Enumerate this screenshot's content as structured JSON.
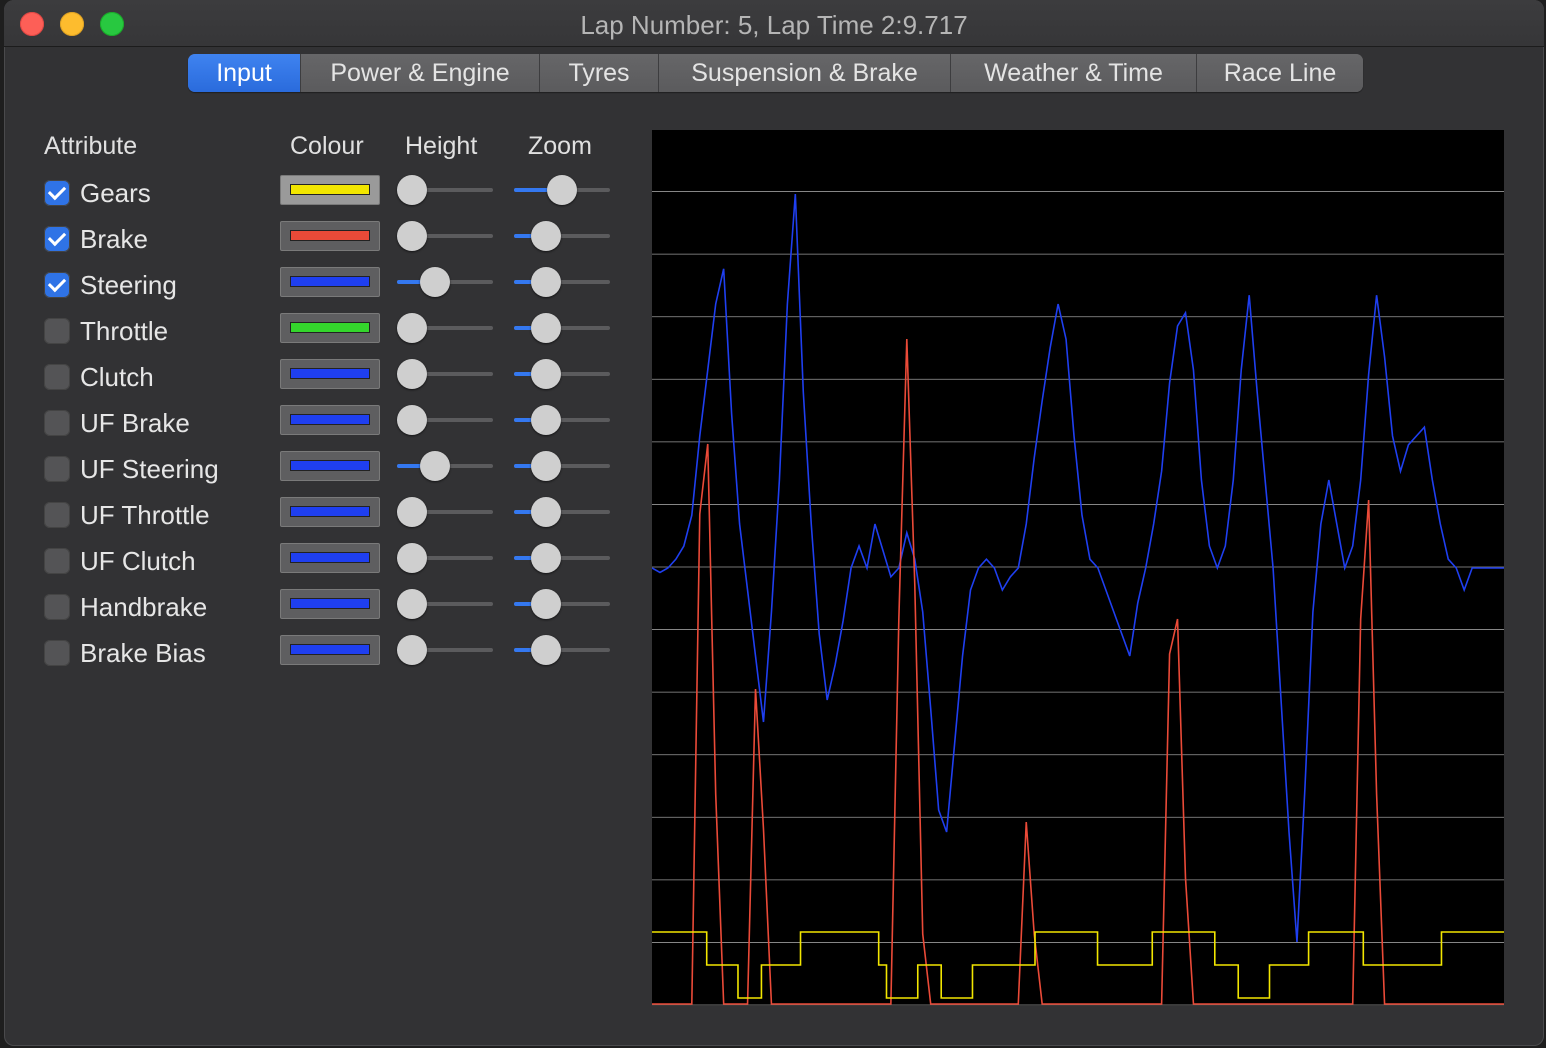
{
  "window": {
    "title": "Lap Number: 5, Lap Time 2:9.717"
  },
  "tabs": [
    {
      "label": "Input",
      "active": true
    },
    {
      "label": "Power & Engine",
      "active": false
    },
    {
      "label": "Tyres",
      "active": false
    },
    {
      "label": "Suspension & Brake",
      "active": false
    },
    {
      "label": "Weather & Time",
      "active": false
    },
    {
      "label": "Race Line",
      "active": false
    }
  ],
  "headers": {
    "attribute": "Attribute",
    "colour": "Colour",
    "height": "Height",
    "zoom": "Zoom"
  },
  "attributes": [
    {
      "label": "Gears",
      "checked": true,
      "colour": "#f2e600",
      "height": 0.0,
      "zoom": 0.5
    },
    {
      "label": "Brake",
      "checked": true,
      "colour": "#ea4a38",
      "height": 0.0,
      "zoom": 0.25
    },
    {
      "label": "Steering",
      "checked": true,
      "colour": "#1f3ff0",
      "height": 0.35,
      "zoom": 0.25
    },
    {
      "label": "Throttle",
      "checked": false,
      "colour": "#34d62c",
      "height": 0.0,
      "zoom": 0.25
    },
    {
      "label": "Clutch",
      "checked": false,
      "colour": "#1f3ff0",
      "height": 0.0,
      "zoom": 0.25
    },
    {
      "label": "UF Brake",
      "checked": false,
      "colour": "#1f3ff0",
      "height": 0.0,
      "zoom": 0.25
    },
    {
      "label": "UF Steering",
      "checked": false,
      "colour": "#1f3ff0",
      "height": 0.35,
      "zoom": 0.25
    },
    {
      "label": "UF Throttle",
      "checked": false,
      "colour": "#1f3ff0",
      "height": 0.0,
      "zoom": 0.25
    },
    {
      "label": "UF Clutch",
      "checked": false,
      "colour": "#1f3ff0",
      "height": 0.0,
      "zoom": 0.25
    },
    {
      "label": "Handbrake",
      "checked": false,
      "colour": "#1f3ff0",
      "height": 0.0,
      "zoom": 0.25
    },
    {
      "label": "Brake Bias",
      "checked": false,
      "colour": "#1f3ff0",
      "height": 0.0,
      "zoom": 0.25
    }
  ],
  "plot": {
    "background": "#000000",
    "grid_color": "#9a9a9a",
    "gridlines": 14,
    "traces": {
      "steering": {
        "color": "#1f3ff0",
        "values": [
          0.0,
          -0.01,
          0.0,
          0.02,
          0.05,
          0.12,
          0.3,
          0.45,
          0.6,
          0.68,
          0.35,
          0.1,
          -0.05,
          -0.2,
          -0.35,
          -0.1,
          0.2,
          0.6,
          0.85,
          0.4,
          0.1,
          -0.15,
          -0.3,
          -0.22,
          -0.12,
          0.0,
          0.05,
          0.0,
          0.1,
          0.04,
          -0.02,
          0.0,
          0.08,
          0.02,
          -0.1,
          -0.32,
          -0.55,
          -0.6,
          -0.4,
          -0.2,
          -0.05,
          0.0,
          0.02,
          0.0,
          -0.05,
          -0.02,
          0.0,
          0.1,
          0.25,
          0.38,
          0.5,
          0.6,
          0.52,
          0.3,
          0.12,
          0.02,
          0.0,
          -0.05,
          -0.1,
          -0.15,
          -0.2,
          -0.08,
          0.0,
          0.1,
          0.22,
          0.42,
          0.55,
          0.58,
          0.45,
          0.2,
          0.05,
          0.0,
          0.05,
          0.2,
          0.45,
          0.62,
          0.4,
          0.2,
          0.0,
          -0.3,
          -0.6,
          -0.85,
          -0.5,
          -0.1,
          0.1,
          0.2,
          0.1,
          0.0,
          0.05,
          0.2,
          0.44,
          0.62,
          0.48,
          0.3,
          0.22,
          0.28,
          0.3,
          0.32,
          0.2,
          0.1,
          0.02,
          0.0,
          -0.05,
          0.0,
          0.0,
          0.0,
          0.0,
          0.0
        ]
      },
      "brake": {
        "color": "#ea4a38",
        "values": [
          0.0,
          0.0,
          0.0,
          0.0,
          0.0,
          0.0,
          0.7,
          0.8,
          0.3,
          0.0,
          0.0,
          0.0,
          0.0,
          0.45,
          0.25,
          0.0,
          0.0,
          0.0,
          0.0,
          0.0,
          0.0,
          0.0,
          0.0,
          0.0,
          0.0,
          0.0,
          0.0,
          0.0,
          0.0,
          0.0,
          0.0,
          0.55,
          0.95,
          0.6,
          0.1,
          0.0,
          0.0,
          0.0,
          0.0,
          0.0,
          0.0,
          0.0,
          0.0,
          0.0,
          0.0,
          0.0,
          0.0,
          0.26,
          0.1,
          0.0,
          0.0,
          0.0,
          0.0,
          0.0,
          0.0,
          0.0,
          0.0,
          0.0,
          0.0,
          0.0,
          0.0,
          0.0,
          0.0,
          0.0,
          0.0,
          0.5,
          0.55,
          0.18,
          0.0,
          0.0,
          0.0,
          0.0,
          0.0,
          0.0,
          0.0,
          0.0,
          0.0,
          0.0,
          0.0,
          0.0,
          0.0,
          0.0,
          0.0,
          0.0,
          0.0,
          0.0,
          0.0,
          0.0,
          0.0,
          0.55,
          0.72,
          0.3,
          0.0,
          0.0,
          0.0,
          0.0,
          0.0,
          0.0,
          0.0,
          0.0,
          0.0,
          0.0,
          0.0,
          0.0,
          0.0,
          0.0,
          0.0,
          0.0
        ]
      },
      "gears": {
        "color": "#f2e600",
        "values": [
          3,
          3,
          3,
          3,
          3,
          3,
          3,
          2,
          2,
          2,
          2,
          1,
          1,
          1,
          2,
          2,
          2,
          2,
          2,
          3,
          3,
          3,
          3,
          3,
          3,
          3,
          3,
          3,
          3,
          2,
          1,
          1,
          1,
          1,
          2,
          2,
          2,
          1,
          1,
          1,
          1,
          2,
          2,
          2,
          2,
          2,
          2,
          2,
          2,
          3,
          3,
          3,
          3,
          3,
          3,
          3,
          3,
          2,
          2,
          2,
          2,
          2,
          2,
          2,
          3,
          3,
          3,
          3,
          3,
          3,
          3,
          3,
          2,
          2,
          2,
          1,
          1,
          1,
          1,
          2,
          2,
          2,
          2,
          2,
          3,
          3,
          3,
          3,
          3,
          3,
          3,
          2,
          2,
          2,
          2,
          2,
          2,
          2,
          2,
          2,
          2,
          3,
          3,
          3,
          3,
          3,
          3,
          3,
          3,
          3
        ]
      }
    }
  }
}
